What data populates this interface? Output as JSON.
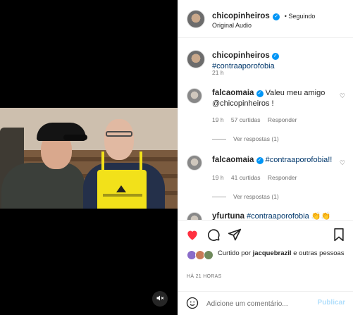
{
  "header": {
    "username": "chicopinheiros",
    "follow_status": "• Seguindo",
    "audio": "Original Audio"
  },
  "caption": {
    "username": "chicopinheiros",
    "text": "#contraaporofobia",
    "time": "21 h"
  },
  "comments": [
    {
      "username": "falcaomaia",
      "text": "Valeu meu amigo @chicopinheiros !",
      "time": "19 h",
      "likes": "57 curtidas",
      "reply": "Responder",
      "view_replies": "Ver respostas (1)"
    },
    {
      "username": "falcaomaia",
      "text": "#contraaporofobia!!",
      "time": "19 h",
      "likes": "41 curtidas",
      "reply": "Responder",
      "view_replies": "Ver respostas (1)"
    },
    {
      "username": "yfurtuna",
      "text": "#contraaporofobia 👏👏"
    }
  ],
  "actions": {
    "liked_by_prefix": "Curtido por",
    "liked_by_user": "jacquebrazil",
    "liked_by_suffix": "e outras pessoas",
    "timestamp": "HÁ 21 HORAS"
  },
  "composer": {
    "placeholder": "Adicione um comentário...",
    "publish": "Publicar"
  },
  "colors": {
    "like_red": "#ff3040",
    "verified_blue": "#0095f6",
    "link_blue": "#00376b"
  },
  "icons": [
    "mute-icon",
    "heart-icon",
    "comment-icon",
    "share-icon",
    "bookmark-icon",
    "emoji-icon",
    "verified-icon"
  ]
}
